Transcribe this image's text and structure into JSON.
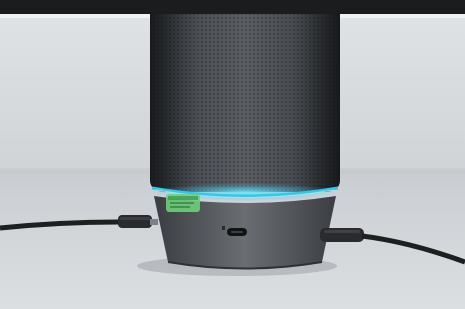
{
  "scene": {
    "description_icon": "bluetooth-speaker-photo",
    "colors": {
      "wall": "#d7dadd",
      "table": "#c9cdd1",
      "speaker_body": "#4a4e53",
      "speaker_base": "#55595e",
      "led_ring": "#33c7e8",
      "cable": "#1e1f21",
      "sticker": "#6dcf7a"
    }
  },
  "sticker": {
    "line1": "",
    "line2": ""
  },
  "port": {
    "label": ""
  }
}
